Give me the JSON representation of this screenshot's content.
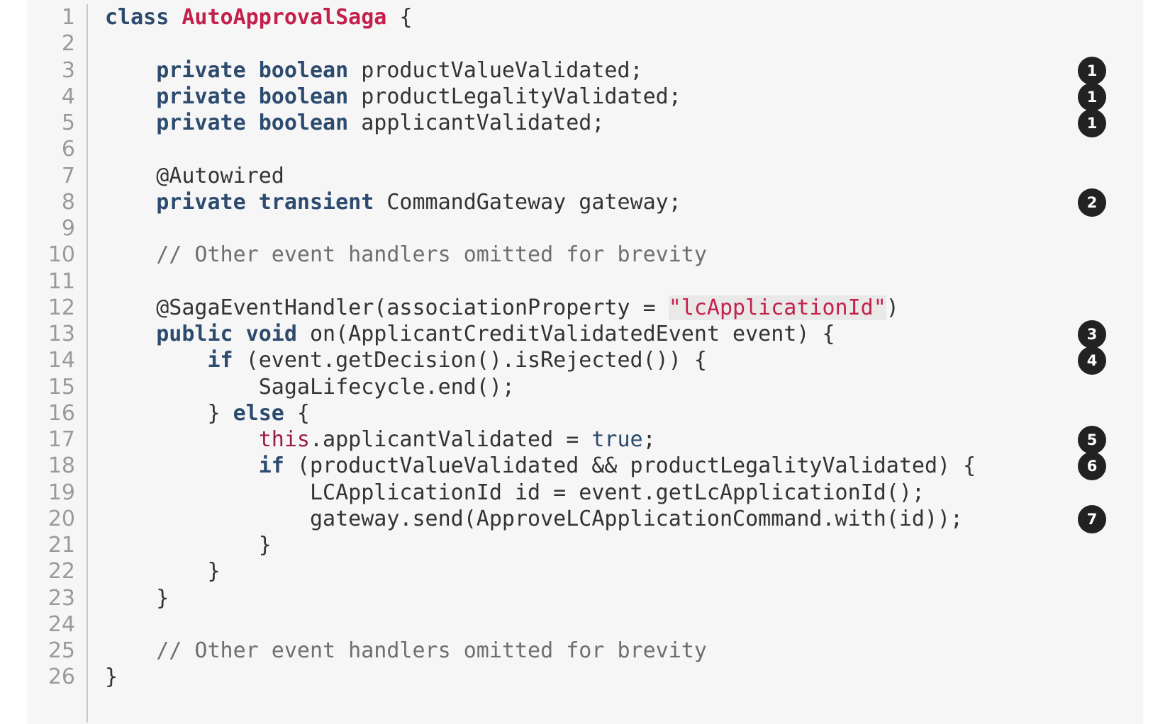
{
  "code": {
    "lines": [
      {
        "num": "1",
        "tokens": [
          {
            "t": "class ",
            "c": "kw"
          },
          {
            "t": "AutoApprovalSaga",
            "c": "cls"
          },
          {
            "t": " {",
            "c": ""
          }
        ]
      },
      {
        "num": "2",
        "tokens": []
      },
      {
        "num": "3",
        "tokens": [
          {
            "t": "    ",
            "c": ""
          },
          {
            "t": "private boolean",
            "c": "kw"
          },
          {
            "t": " productValueValidated;",
            "c": ""
          }
        ],
        "callout": "1"
      },
      {
        "num": "4",
        "tokens": [
          {
            "t": "    ",
            "c": ""
          },
          {
            "t": "private boolean",
            "c": "kw"
          },
          {
            "t": " productLegalityValidated;",
            "c": ""
          }
        ],
        "callout": "1"
      },
      {
        "num": "5",
        "tokens": [
          {
            "t": "    ",
            "c": ""
          },
          {
            "t": "private boolean",
            "c": "kw"
          },
          {
            "t": " applicantValidated;",
            "c": ""
          }
        ],
        "callout": "1"
      },
      {
        "num": "6",
        "tokens": []
      },
      {
        "num": "7",
        "tokens": [
          {
            "t": "    @Autowired",
            "c": ""
          }
        ]
      },
      {
        "num": "8",
        "tokens": [
          {
            "t": "    ",
            "c": ""
          },
          {
            "t": "private transient",
            "c": "kw"
          },
          {
            "t": " CommandGateway gateway;",
            "c": ""
          }
        ],
        "callout": "2"
      },
      {
        "num": "9",
        "tokens": []
      },
      {
        "num": "10",
        "tokens": [
          {
            "t": "    ",
            "c": ""
          },
          {
            "t": "// Other event handlers omitted for brevity",
            "c": "cmt"
          }
        ]
      },
      {
        "num": "11",
        "tokens": []
      },
      {
        "num": "12",
        "tokens": [
          {
            "t": "    @SagaEventHandler(associationProperty = ",
            "c": ""
          },
          {
            "t": "\"lcApplicationId\"",
            "c": "str"
          },
          {
            "t": ")",
            "c": ""
          }
        ]
      },
      {
        "num": "13",
        "tokens": [
          {
            "t": "    ",
            "c": ""
          },
          {
            "t": "public void",
            "c": "kw"
          },
          {
            "t": " on(ApplicantCreditValidatedEvent event) {",
            "c": ""
          }
        ],
        "callout": "3"
      },
      {
        "num": "14",
        "tokens": [
          {
            "t": "        ",
            "c": ""
          },
          {
            "t": "if",
            "c": "kw"
          },
          {
            "t": " (event.getDecision().isRejected()) {",
            "c": ""
          }
        ],
        "callout": "4"
      },
      {
        "num": "15",
        "tokens": [
          {
            "t": "            SagaLifecycle.end();",
            "c": ""
          }
        ]
      },
      {
        "num": "16",
        "tokens": [
          {
            "t": "        } ",
            "c": ""
          },
          {
            "t": "else",
            "c": "kw"
          },
          {
            "t": " {",
            "c": ""
          }
        ]
      },
      {
        "num": "17",
        "tokens": [
          {
            "t": "            ",
            "c": ""
          },
          {
            "t": "this",
            "c": "this"
          },
          {
            "t": ".applicantValidated = ",
            "c": ""
          },
          {
            "t": "true",
            "c": "lit"
          },
          {
            "t": ";",
            "c": ""
          }
        ],
        "callout": "5"
      },
      {
        "num": "18",
        "tokens": [
          {
            "t": "            ",
            "c": ""
          },
          {
            "t": "if",
            "c": "kw"
          },
          {
            "t": " (productValueValidated && productLegalityValidated) {",
            "c": ""
          }
        ],
        "callout": "6"
      },
      {
        "num": "19",
        "tokens": [
          {
            "t": "                LCApplicationId id = event.getLcApplicationId();",
            "c": ""
          }
        ]
      },
      {
        "num": "20",
        "tokens": [
          {
            "t": "                gateway.send(ApproveLCApplicationCommand.with(id));",
            "c": ""
          }
        ],
        "callout": "7"
      },
      {
        "num": "21",
        "tokens": [
          {
            "t": "            }",
            "c": ""
          }
        ]
      },
      {
        "num": "22",
        "tokens": [
          {
            "t": "        }",
            "c": ""
          }
        ]
      },
      {
        "num": "23",
        "tokens": [
          {
            "t": "    }",
            "c": ""
          }
        ]
      },
      {
        "num": "24",
        "tokens": []
      },
      {
        "num": "25",
        "tokens": [
          {
            "t": "    ",
            "c": ""
          },
          {
            "t": "// Other event handlers omitted for brevity",
            "c": "cmt"
          }
        ]
      },
      {
        "num": "26",
        "tokens": [
          {
            "t": "}",
            "c": ""
          }
        ]
      }
    ]
  }
}
